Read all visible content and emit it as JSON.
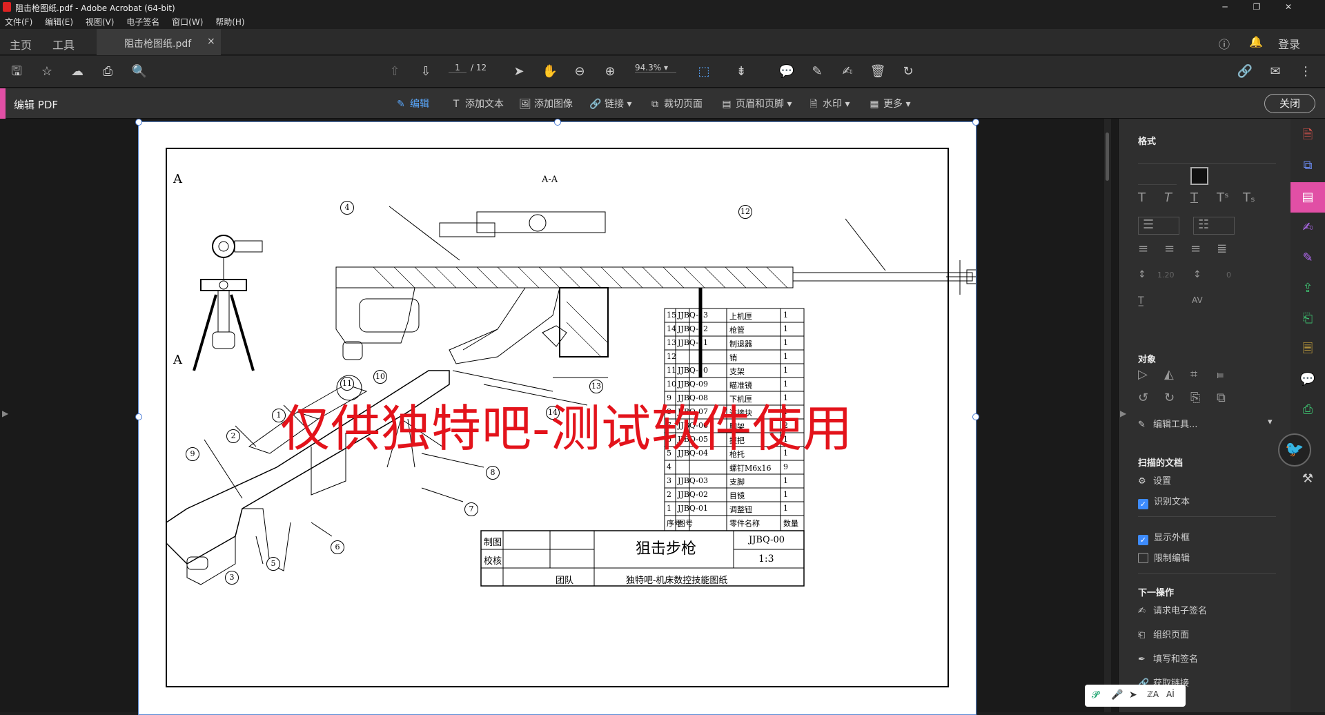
{
  "window": {
    "title": "阻击枪图纸.pdf - Adobe Acrobat (64-bit)",
    "min": "─",
    "max": "❐",
    "close": "✕"
  },
  "menu": [
    "文件(F)",
    "编辑(E)",
    "视图(V)",
    "电子签名",
    "窗口(W)",
    "帮助(H)"
  ],
  "tabs": {
    "home": "主页",
    "tools": "工具",
    "doc": "阻击枪图纸.pdf",
    "doc_close": "×",
    "login": "登录"
  },
  "toolbar": {
    "page_current": "1",
    "page_total": "/ 12",
    "zoom": "94.3%"
  },
  "editbar": {
    "title": "编辑 PDF",
    "tools": [
      {
        "label": "编辑",
        "icon": "edit-icon",
        "active": true
      },
      {
        "label": "添加文本",
        "icon": "text-icon"
      },
      {
        "label": "添加图像",
        "icon": "image-icon"
      },
      {
        "label": "链接 ▾",
        "icon": "link-icon"
      },
      {
        "label": "裁切页面",
        "icon": "crop-icon"
      },
      {
        "label": "页眉和页脚 ▾",
        "icon": "header-footer-icon"
      },
      {
        "label": "水印 ▾",
        "icon": "watermark-icon"
      },
      {
        "label": "更多 ▾",
        "icon": "more-icon"
      }
    ],
    "close": "关闭"
  },
  "document": {
    "watermark": "仅供独特吧-测试软件使用",
    "view_label_a1": "A",
    "view_label_a2": "A",
    "section_label": "A-A",
    "parts_table": [
      [
        "15",
        "JJBQ-13",
        "上机匣",
        "1"
      ],
      [
        "14",
        "JJBQ-12",
        "枪管",
        "1"
      ],
      [
        "13",
        "JJBQ-11",
        "制退器",
        "1"
      ],
      [
        "12",
        "",
        "销",
        "1"
      ],
      [
        "11",
        "JJBQ-10",
        "支架",
        "1"
      ],
      [
        "10",
        "JJBQ-09",
        "瞄准镜",
        "1"
      ],
      [
        "9",
        "JJBQ-08",
        "下机匣",
        "1"
      ],
      [
        "8",
        "JJBQ-07",
        "连接块",
        "1"
      ],
      [
        "7",
        "JJBQ-06",
        "脚架",
        "2"
      ],
      [
        "6",
        "JJBQ-05",
        "握把",
        "1"
      ],
      [
        "5",
        "JJBQ-04",
        "枪托",
        "1"
      ],
      [
        "4",
        "",
        "螺钉M6x16",
        "9"
      ],
      [
        "3",
        "JJBQ-03",
        "支脚",
        "1"
      ],
      [
        "2",
        "JJBQ-02",
        "目镜",
        "1"
      ],
      [
        "1",
        "JJBQ-01",
        "调整钮",
        "1"
      ]
    ],
    "table_header": [
      "序号",
      "图号",
      "零件名称",
      "数量"
    ],
    "title_block": {
      "drawn": "制图",
      "checked": "校核",
      "team": "团队",
      "name": "狙击步枪",
      "code": "JJBQ-00",
      "scale": "1:3",
      "org": "独特吧-机床数控技能图纸"
    },
    "balloons": [
      "1",
      "2",
      "3",
      "4",
      "5",
      "6",
      "7",
      "8",
      "9",
      "10",
      "11",
      "12",
      "13",
      "14"
    ]
  },
  "rpanel": {
    "format": "格式",
    "line_spacing": "1.20",
    "char_spacing": "0",
    "objects": "对象",
    "edit_tools": "编辑工具...",
    "scanned": "扫描的文档",
    "settings": "设置",
    "ocr": "识别文本",
    "show_bbox": "显示外框",
    "restrict_edit": "限制编辑",
    "next": "下一操作",
    "next_items": [
      "请求电子签名",
      "组织页面",
      "填写和签名",
      "获取链接"
    ]
  },
  "floatbar": [
    "𝓟",
    "🎤",
    "➤",
    "ℤA",
    "Aİ"
  ],
  "colors": {
    "accent": "#e14fa5",
    "watermark": "#e3131b",
    "link": "#5aa9ff"
  }
}
